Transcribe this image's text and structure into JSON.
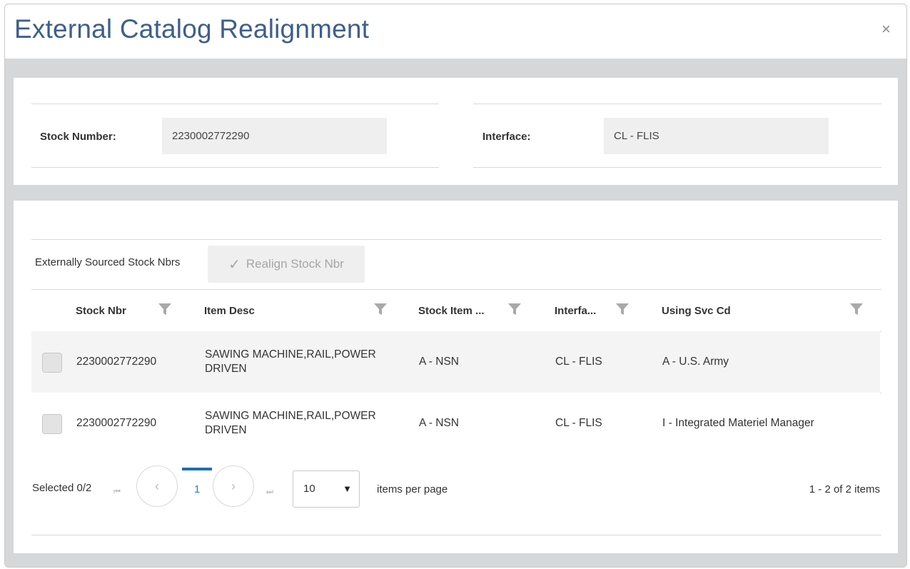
{
  "dialog": {
    "title": "External Catalog Realignment",
    "close_glyph": "×"
  },
  "header_fields": {
    "stock_number_label": "Stock Number:",
    "stock_number_value": "2230002772290",
    "interface_label": "Interface:",
    "interface_value": "CL - FLIS"
  },
  "grid": {
    "title": "Externally Sourced Stock Nbrs",
    "realign_button": {
      "label": "Realign Stock Nbr",
      "icon": "check-icon",
      "enabled": false
    },
    "columns": [
      "Stock Nbr",
      "Item Desc",
      "Stock Item ...",
      "Interfa...",
      "Using Svc Cd"
    ],
    "rows": [
      {
        "stock_nbr": "2230002772290",
        "item_desc_line1": "SAWING MACHINE,RAIL,POWER",
        "item_desc_line2": "DRIVEN",
        "stock_item": "A - NSN",
        "interface": "CL - FLIS",
        "using_svc_cd": "A - U.S. Army"
      },
      {
        "stock_nbr": "2230002772290",
        "item_desc_line1": "SAWING MACHINE,RAIL,POWER",
        "item_desc_line2": "DRIVEN",
        "stock_item": "A - NSN",
        "interface": "CL - FLIS",
        "using_svc_cd": "I - Integrated Materiel Manager"
      }
    ]
  },
  "pager": {
    "selected": "Selected 0/2",
    "first_glyph": "⏮",
    "prev_glyph": "‹",
    "current_page": "1",
    "next_glyph": "›",
    "last_glyph": "⏭",
    "page_size": "10",
    "dropdown_glyph": "▼",
    "items_per_page": "items per page",
    "range": "1 - 2 of 2 items"
  },
  "colors": {
    "title": "#3e5f8a",
    "accent": "#1f6db5",
    "frame": "#d6d7d9"
  }
}
